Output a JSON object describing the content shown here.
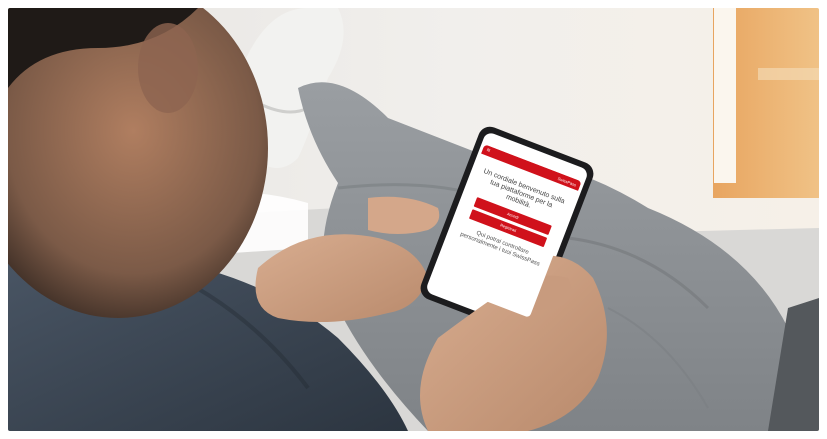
{
  "scene": {
    "description_subject": "photo",
    "colors": {
      "brand_red": "#d0111b",
      "wall": "#ece9e4",
      "trousers": "#8e9296",
      "shirt": "#3b4652",
      "skin": "#c99a7d"
    }
  },
  "phone_screen": {
    "app_name": "SwissPass",
    "menu_icon": "hamburger-menu-icon",
    "headline": "Un cordiale benvenuto sulla tua piattaforme per la mobilità.",
    "login_label": "Accedi",
    "register_label": "Registrati",
    "subtext": "Qui potrai controllare personalmente i tuoi SwissPass"
  }
}
